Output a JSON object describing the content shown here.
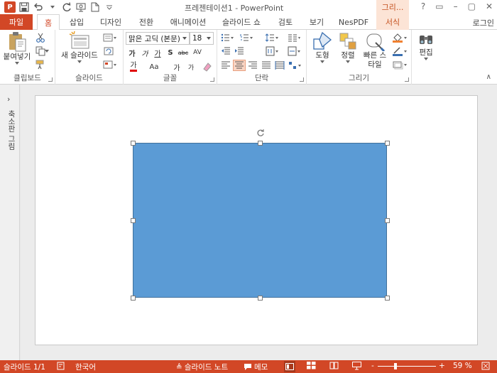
{
  "window": {
    "title": "프레젠테이션1 - PowerPoint",
    "context_title": "그리...",
    "app_logo": "P"
  },
  "tabs": {
    "file": "파일",
    "home": "홈",
    "insert": "삽입",
    "design": "디자인",
    "transitions": "전환",
    "animations": "애니메이션",
    "slideshow": "슬라이드 쇼",
    "review": "검토",
    "view": "보기",
    "nespdf": "NesPDF",
    "format": "서식",
    "login": "로그인"
  },
  "ribbon": {
    "clipboard": {
      "label": "클립보드",
      "paste": "붙여넣기"
    },
    "slides": {
      "label": "슬라이드",
      "new_slide": "새 슬라이드"
    },
    "font": {
      "label": "글꼴",
      "font_name": "맑은 고딕 (본문)",
      "font_size": "18",
      "bold": "가",
      "italic": "가",
      "underline": "가",
      "shadow": "S",
      "strike": "abc",
      "spacing": "AV",
      "font_color": "가",
      "case": "Aa",
      "grow": "가",
      "shrink": "가"
    },
    "paragraph": {
      "label": "단락"
    },
    "drawing": {
      "label": "그리기",
      "shapes": "도형",
      "arrange": "정렬",
      "quick_styles": "빠른 스타일"
    },
    "editing": {
      "label": "편집"
    }
  },
  "left_pane": {
    "label": "축소판 그림"
  },
  "status": {
    "slide_info": "슬라이드 1/1",
    "language": "한국어",
    "notes": "슬라이드 노트",
    "comments": "메모",
    "zoom": "59 %",
    "zoom_minus": "-",
    "zoom_plus": "+"
  },
  "colors": {
    "accent": "#d24726",
    "shape_fill": "#5b9bd5",
    "shape_border": "#41719c",
    "context_tab": "#fce4d6"
  }
}
